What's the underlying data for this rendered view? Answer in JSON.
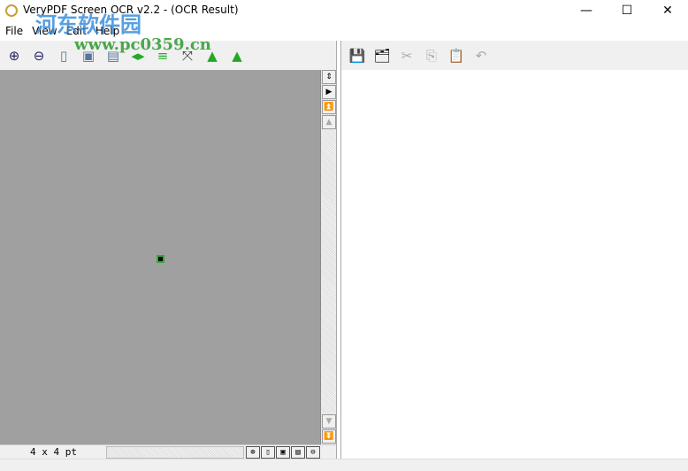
{
  "window": {
    "title": "VeryPDF Screen OCR v2.2 - (OCR Result)",
    "minimize": "—",
    "maximize": "☐",
    "close": "✕"
  },
  "menu": [
    "File",
    "View",
    "Edit",
    "Help"
  ],
  "left_toolbar": [
    "zoom-in",
    "zoom-out",
    "fit-page",
    "fit-width",
    "actual-size",
    "flip-vertical",
    "flip-horizontal",
    "fit-window",
    "rotate-left",
    "rotate-right"
  ],
  "right_toolbar": [
    "save",
    "save-all",
    "cut",
    "copy",
    "paste",
    "undo"
  ],
  "status": {
    "size": "4 x 4 pt"
  },
  "watermark": {
    "cn": "河东软件园",
    "url": "www.pc0359.cn"
  }
}
